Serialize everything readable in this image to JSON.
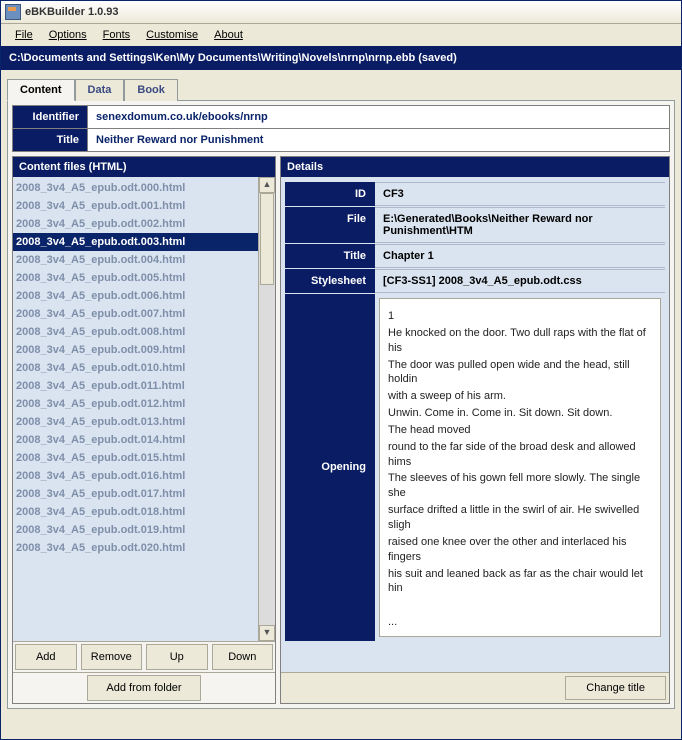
{
  "window": {
    "title": "eBKBuilder 1.0.93"
  },
  "menu": [
    "File",
    "Options",
    "Fonts",
    "Customise",
    "About"
  ],
  "path": "C:\\Documents and Settings\\Ken\\My Documents\\Writing\\Novels\\nrnp\\nrnp.ebb (saved)",
  "tabs": [
    "Content",
    "Data",
    "Book"
  ],
  "header": {
    "identifier_label": "Identifier",
    "identifier": "senexdomum.co.uk/ebooks/nrnp",
    "title_label": "Title",
    "title": "Neither Reward nor Punishment"
  },
  "left": {
    "heading": "Content files (HTML)",
    "selected_index": 3,
    "files": [
      "2008_3v4_A5_epub.odt.000.html",
      "2008_3v4_A5_epub.odt.001.html",
      "2008_3v4_A5_epub.odt.002.html",
      "2008_3v4_A5_epub.odt.003.html",
      "2008_3v4_A5_epub.odt.004.html",
      "2008_3v4_A5_epub.odt.005.html",
      "2008_3v4_A5_epub.odt.006.html",
      "2008_3v4_A5_epub.odt.007.html",
      "2008_3v4_A5_epub.odt.008.html",
      "2008_3v4_A5_epub.odt.009.html",
      "2008_3v4_A5_epub.odt.010.html",
      "2008_3v4_A5_epub.odt.011.html",
      "2008_3v4_A5_epub.odt.012.html",
      "2008_3v4_A5_epub.odt.013.html",
      "2008_3v4_A5_epub.odt.014.html",
      "2008_3v4_A5_epub.odt.015.html",
      "2008_3v4_A5_epub.odt.016.html",
      "2008_3v4_A5_epub.odt.017.html",
      "2008_3v4_A5_epub.odt.018.html",
      "2008_3v4_A5_epub.odt.019.html",
      "2008_3v4_A5_epub.odt.020.html"
    ],
    "buttons": [
      "Add",
      "Remove",
      "Up",
      "Down"
    ],
    "add_folder": "Add from folder"
  },
  "right": {
    "heading": "Details",
    "rows": [
      {
        "k": "ID",
        "v": "CF3"
      },
      {
        "k": "File",
        "v": "E:\\Generated\\Books\\Neither Reward nor Punishment\\HTM"
      },
      {
        "k": "Title",
        "v": "Chapter 1"
      },
      {
        "k": "Stylesheet",
        "v": "[CF3-SS1] 2008_3v4_A5_epub.odt.css"
      }
    ],
    "opening_label": "Opening",
    "opening_lines": [
      " 1",
      "He knocked on the door. Two dull raps with the flat of his",
      "The door was pulled open wide and the head, still holdin",
      "with a sweep of his arm.",
      "Unwin. Come in. Come in. Sit down. Sit down.",
      "The head moved",
      "round to the far side of the broad desk and allowed hims",
      "The sleeves of his gown fell more slowly. The single she",
      "surface drifted a little in the swirl of air. He swivelled sligh",
      "raised one knee over the other and interlaced his  fingers",
      "his suit and leaned back as far as the chair would let hin",
      "",
      "..."
    ],
    "change_title": "Change title"
  }
}
